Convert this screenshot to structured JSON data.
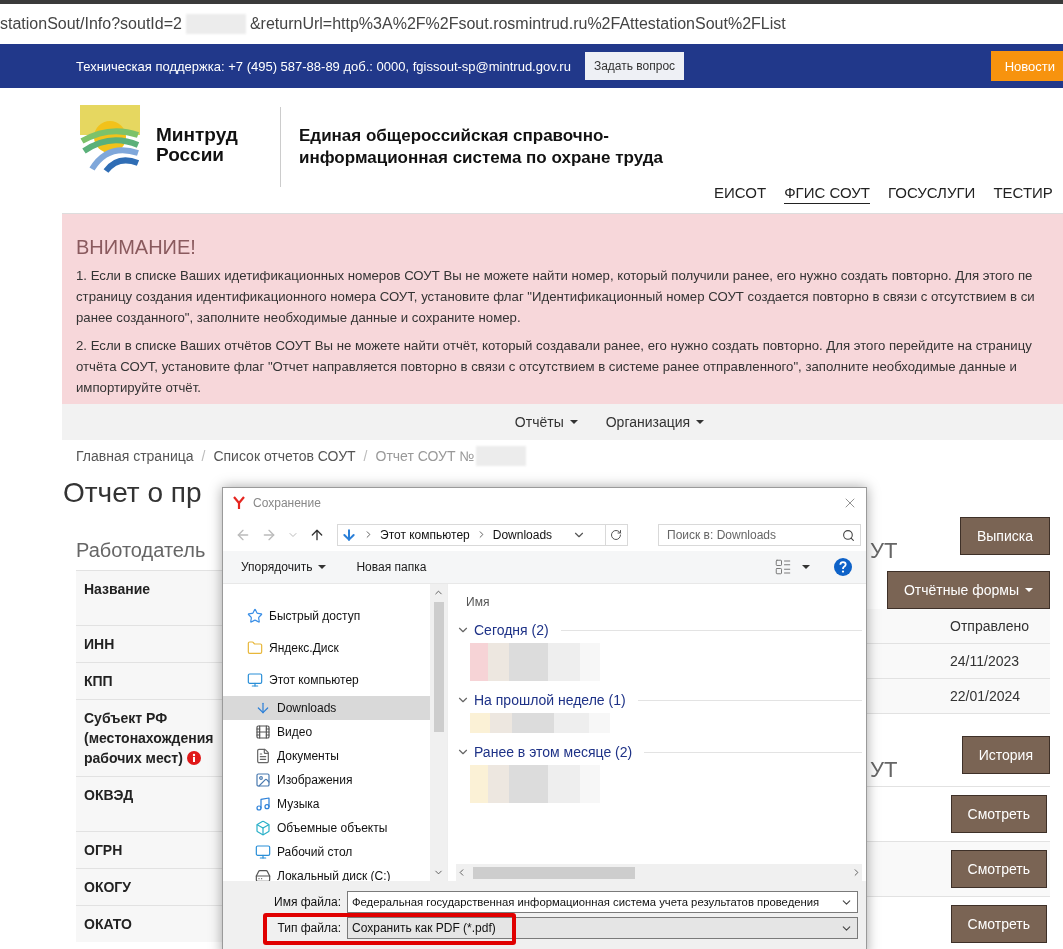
{
  "browser": {
    "url_start": "stationSout/Info?soutId=2",
    "url_end": "&returnUrl=http%3A%2F%2Fsout.rosmintrud.ru%2FAttestationSout%2FList"
  },
  "support_bar": {
    "text": "Техническая поддержка: +7 (495) 587-88-89 доб.: 0000, fgissout-sp@mintrud.gov.ru",
    "ask_button": "Задать вопрос",
    "news_button": "Новости"
  },
  "header": {
    "brand": "Минтруд России",
    "title": "Единая общероссийская справочно-информационная система по охране труда",
    "nav": [
      {
        "label": "ЕИСОТ",
        "selected": false
      },
      {
        "label": "ФГИС СОУТ",
        "selected": true
      },
      {
        "label": "ГОСУСЛУГИ",
        "selected": false
      },
      {
        "label": "ТЕСТИР",
        "selected": false
      }
    ]
  },
  "alert": {
    "title": "ВНИМАНИЕ!",
    "paragraphs": [
      [
        "1. Если в списке Ваших идетификационных номеров СОУТ Вы не можете найти номер, который получили ранее, его нужно создать повторно. Для этого пе",
        "страницу создания идентификационного номера СОУТ, установите флаг \"Идентификационный номер СОУТ создается повторно в связи с отсутствием в си",
        "ранее созданного\", заполните необходимые данные и сохраните номер."
      ],
      [
        "2. Если в списке Ваших отчётов СОУТ Вы не можете найти отчёт, который создавали ранее, его нужно создать повторно. Для этого перейдите на страницу",
        "отчёта СОУТ, установите флаг \"Отчет направляется повторно в связи с отсутствием в системе ранее отправленного\", заполните необходимые данные и",
        "импортируйте отчёт."
      ]
    ]
  },
  "menu": [
    "Отчёты",
    "Организация"
  ],
  "breadcrumbs": [
    {
      "label": "Главная страница",
      "current": false
    },
    {
      "separator": "/",
      "label": "Список отчетов СОУТ",
      "current": false
    },
    {
      "separator": "/",
      "label": "Отчет СОУТ №",
      "current": true
    }
  ],
  "page_title": "Отчет о пр",
  "employer": {
    "title": "Работодатель",
    "rows": [
      {
        "label": "Название",
        "kind": "tall",
        "info": false
      },
      {
        "label": "ИНН",
        "kind": "plain",
        "info": false
      },
      {
        "label": "КПП",
        "kind": "plain",
        "info": false
      },
      {
        "label": "Субъект РФ (местонахождения рабочих мест)",
        "kind": "plain",
        "info": true
      },
      {
        "label": "ОКВЭД",
        "kind": "tall",
        "info": false
      },
      {
        "label": "ОГРН",
        "kind": "plain",
        "info": false
      },
      {
        "label": "ОКОГУ",
        "kind": "plain",
        "info": false
      },
      {
        "label": "ОКАТО",
        "kind": "plain",
        "info": false
      }
    ]
  },
  "report": {
    "title": "УТ",
    "extract_button": "Выписка",
    "forms_button": "Отчётные формы",
    "rows": [
      "Отправлено",
      "24/11/2023",
      "22/01/2024"
    ]
  },
  "history": {
    "title": "УТ",
    "history_button": "История",
    "rows": [
      "Смотреть",
      "Смотреть",
      "Смотреть"
    ]
  },
  "dialog": {
    "title": "Сохранение",
    "path": [
      "Этот компьютер",
      "Downloads"
    ],
    "search_placeholder": "Поиск в: Downloads",
    "organize": "Упорядочить",
    "new_folder": "Новая папка",
    "column_header": "Имя",
    "nav": [
      {
        "label": "Быстрый доступ",
        "kind": "quick",
        "selected": false
      },
      {
        "label": "Яндекс.Диск",
        "kind": "cloud",
        "selected": false
      },
      {
        "label": "Этот компьютер",
        "kind": "computer",
        "selected": false,
        "children": [
          {
            "label": "Downloads",
            "kind": "downloads",
            "selected": true
          },
          {
            "label": "Видео",
            "kind": "video",
            "selected": false
          },
          {
            "label": "Документы",
            "kind": "documents",
            "selected": false
          },
          {
            "label": "Изображения",
            "kind": "images",
            "selected": false
          },
          {
            "label": "Музыка",
            "kind": "music",
            "selected": false
          },
          {
            "label": "Объемные объекты",
            "kind": "objects",
            "selected": false
          },
          {
            "label": "Рабочий стол",
            "kind": "desktop",
            "selected": false
          },
          {
            "label": "Локальный диск (C:)",
            "kind": "disk",
            "selected": false
          }
        ]
      }
    ],
    "groups": [
      {
        "label": "Сегодня (2)",
        "expanded": true
      },
      {
        "label": "На прошлой неделе (1)",
        "expanded": true
      },
      {
        "label": "Ранее в этом месяце (2)",
        "expanded": true
      }
    ],
    "file_name": {
      "label": "Имя файла:",
      "value": "Федеральная государственная информационная система учета результатов проведения"
    },
    "file_type": {
      "label": "Тип файла:",
      "value": "Сохранить как PDF (*.pdf)",
      "highlighted": true
    }
  }
}
